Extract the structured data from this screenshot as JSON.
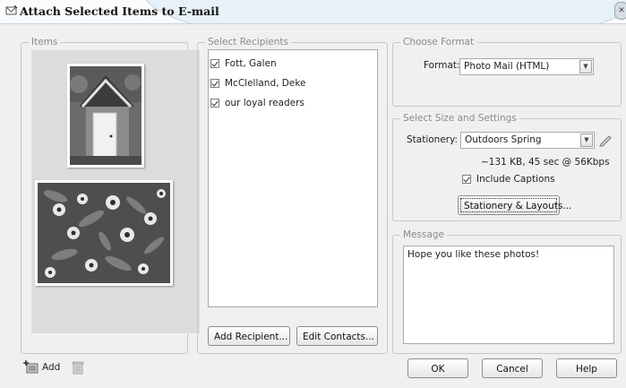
{
  "window": {
    "title": "Attach Selected Items to E-mail"
  },
  "items": {
    "legend": "Items",
    "add_label": "Add"
  },
  "recipients": {
    "legend": "Select Recipients",
    "list": [
      {
        "name": "Fott, Galen",
        "checked": true
      },
      {
        "name": "McClelland, Deke",
        "checked": true
      },
      {
        "name": "our loyal readers",
        "checked": true
      }
    ],
    "add_button": "Add Recipient...",
    "edit_button": "Edit Contacts..."
  },
  "format": {
    "legend": "Choose Format",
    "label": "Format:",
    "value": "Photo Mail (HTML)"
  },
  "settings": {
    "legend": "Select Size and Settings",
    "stationery_label": "Stationery:",
    "stationery_value": "Outdoors Spring",
    "size_info": "~131 KB, 45 sec @ 56Kbps",
    "include_captions_label": "Include Captions",
    "include_captions_checked": true,
    "layouts_button": "Stationery & Layouts..."
  },
  "message": {
    "legend": "Message",
    "text": "Hope you like these photos!"
  },
  "footer": {
    "ok": "OK",
    "cancel": "Cancel",
    "help": "Help"
  }
}
